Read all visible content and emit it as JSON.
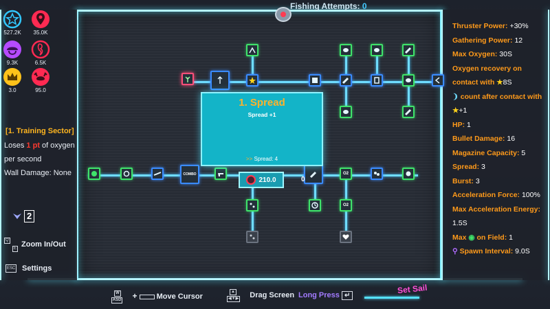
{
  "top": {
    "fishing_label": "Fishing Attempts:",
    "fishing_count": "0"
  },
  "resources": [
    {
      "icon": "star-icon",
      "color": "#32c8ff",
      "value": "527.2K"
    },
    {
      "icon": "location-pin-icon",
      "color": "#ff2a52",
      "value": "35.0K"
    },
    {
      "icon": "jellyfish-icon",
      "color": "#b54bff",
      "value": "9.3K"
    },
    {
      "icon": "seahorse-icon",
      "color": "#ff2a52",
      "value": "6.5K"
    },
    {
      "icon": "crown-icon",
      "color": "#ffc21a",
      "value": "3.0"
    },
    {
      "icon": "crab-icon",
      "color": "#ff2a52",
      "value": "95.0"
    }
  ],
  "sector": {
    "title": "[1. Training Sector]",
    "line1_pre": "Loses",
    "line1_red": "1 pt",
    "line1_post": "of oxygen",
    "line2": "per second",
    "line3": "Wall Damage: None"
  },
  "level_indicator": "2",
  "controls": {
    "zoom_keys_top": "Q",
    "zoom_keys_bottom": "E",
    "zoom_label": "Zoom In/Out",
    "settings_key": "ESC",
    "settings_label": "Settings"
  },
  "tooltip": {
    "title": "1. Spread",
    "effect": "Spread +1",
    "next_arrow": ">>",
    "next": "Spread: 4",
    "cost": "210.0",
    "side_value": "0"
  },
  "node_labels": {
    "combo": "COMBO",
    "o2": "O2"
  },
  "stats": {
    "thruster_label": "Thruster Power:",
    "thruster_value": "+30%",
    "gathering_label": "Gathering Power:",
    "gathering_value": "12",
    "oxygen_label": "Max Oxygen:",
    "oxygen_value": "30S",
    "recovery_label_1": "Oxygen recovery on",
    "recovery_label_2": "contact with",
    "recovery_value": "8S",
    "count_label_1": "count after contact with",
    "count_value": "+1",
    "hp_label": "HP:",
    "hp_value": "1",
    "bullet_label": "Bullet Damage:",
    "bullet_value": "16",
    "magazine_label": "Magazine Capacity:",
    "magazine_value": "5",
    "spread_label": "Spread:",
    "spread_value": "3",
    "burst_label": "Burst:",
    "burst_value": "3",
    "accel_label": "Acceleration Force:",
    "accel_value": "100%",
    "maxaccel_label": "Max Acceleration Energy:",
    "maxaccel_value": "1.5S",
    "field_label_pre": "Max",
    "field_label_post": "on Field:",
    "field_value": "1",
    "spawn_label": "Spawn Interval:",
    "spawn_value": "9.0S"
  },
  "bottom": {
    "move_label": "Move Cursor",
    "drag_label": "Drag Screen",
    "long_press_label": "Long Press",
    "set_sail_label": "Set Sail",
    "keys_w": "W",
    "keys_asd": "ASD",
    "arrow_up": "▲",
    "arrow_row": "◀▼▶"
  },
  "colors": {
    "accent_cyan": "#6fdcff",
    "node_green": "#3fe36a",
    "node_blue": "#3a8bff",
    "stat_orange": "#ff9a1a",
    "tooltip_bg": "#13b4c8"
  }
}
